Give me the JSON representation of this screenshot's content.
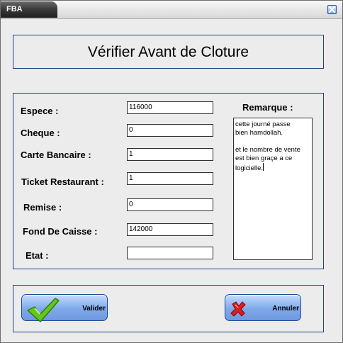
{
  "window": {
    "app_title": "FBA"
  },
  "header": {
    "title": "Vérifier Avant de Cloture"
  },
  "form": {
    "fields": [
      {
        "key": "espece",
        "label": "Espece :",
        "value": "116000"
      },
      {
        "key": "cheque",
        "label": "Cheque :",
        "value": "0"
      },
      {
        "key": "carte",
        "label": "Carte Bancaire :",
        "value": "1"
      },
      {
        "key": "ticket",
        "label": "Ticket Restaurant :",
        "value": "1"
      },
      {
        "key": "remise",
        "label": "Remise :",
        "value": "0"
      },
      {
        "key": "fond",
        "label": "Fond De Caisse :",
        "value": "142000"
      },
      {
        "key": "etat",
        "label": "Etat :",
        "value": ""
      }
    ],
    "remark": {
      "label": "Remarque :",
      "text": "cette journé passe\nbien hamdollah.\n\net le nombre de vente\nest bien graçe a ce\nlogicielle."
    }
  },
  "actions": {
    "validate_label": "Valider",
    "cancel_label": "Annuler"
  },
  "icons": {
    "validate": "checkmark-icon",
    "cancel": "x-icon",
    "close": "close-icon"
  },
  "colors": {
    "border": "#1f3f83",
    "button_blue": "#7ea9ea",
    "check_green": "#67c51f",
    "cancel_red": "#d82020"
  }
}
